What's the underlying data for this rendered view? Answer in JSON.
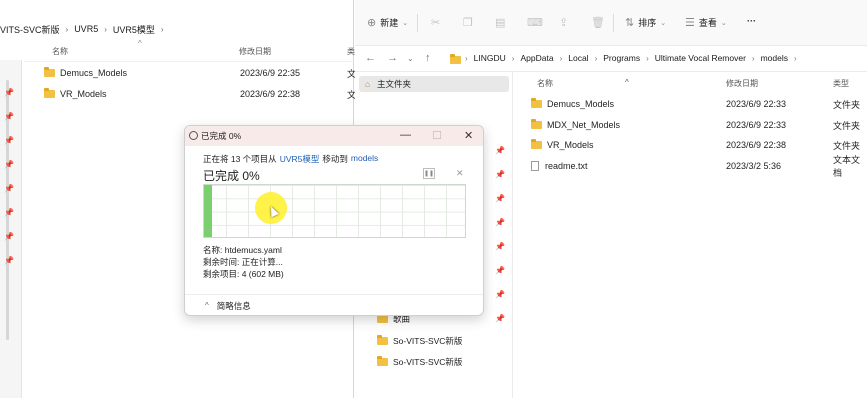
{
  "left": {
    "breadcrumb": [
      "VITS-SVC新版",
      "UVR5",
      "UVR5模型"
    ],
    "columns": {
      "name": "名称",
      "date": "修改日期",
      "type": "类"
    },
    "rows": [
      {
        "name": "Demucs_Models",
        "date": "2023/6/9 22:35",
        "type": "文"
      },
      {
        "name": "VR_Models",
        "date": "2023/6/9 22:38",
        "type": "文"
      }
    ]
  },
  "right": {
    "toolbar": {
      "new_label": "新建",
      "sort_label": "排序",
      "view_label": "查看",
      "more_label": "···"
    },
    "address": [
      "LINGDU",
      "AppData",
      "Local",
      "Programs",
      "Ultimate Vocal Remover",
      "models"
    ],
    "nav": {
      "home_label": "主文件夹",
      "items": [
        {
          "label": "歌曲"
        },
        {
          "label": "So-VITS-SVC新版"
        },
        {
          "label": "So-VITS-SVC新版"
        }
      ]
    },
    "columns": {
      "name": "名称",
      "date": "修改日期",
      "type": "类型"
    },
    "rows": [
      {
        "name": "Demucs_Models",
        "date": "2023/6/9 22:33",
        "type": "文件夹",
        "kind": "folder"
      },
      {
        "name": "MDX_Net_Models",
        "date": "2023/6/9 22:33",
        "type": "文件夹",
        "kind": "folder"
      },
      {
        "name": "VR_Models",
        "date": "2023/6/9 22:38",
        "type": "文件夹",
        "kind": "folder"
      },
      {
        "name": "readme.txt",
        "date": "2023/3/2 5:36",
        "type": "文本文档",
        "kind": "file"
      }
    ]
  },
  "dialog": {
    "title": "已完成 0%",
    "line_prefix": "正在将 13 个项目从",
    "source": "UVR5模型",
    "line_mid": "移动到",
    "dest": "models",
    "percent_text": "已完成 0%",
    "progress": 0.03,
    "name_line": "名称: htdemucs.yaml",
    "time_line": "剩余时间: 正在计算...",
    "items_line": "剩余项目: 4 (602 MB)",
    "details_label": "简略信息",
    "colors": {
      "progress": "#7ccf6e",
      "link": "#1e5fb4",
      "title_bg": "#f7eae8"
    }
  }
}
